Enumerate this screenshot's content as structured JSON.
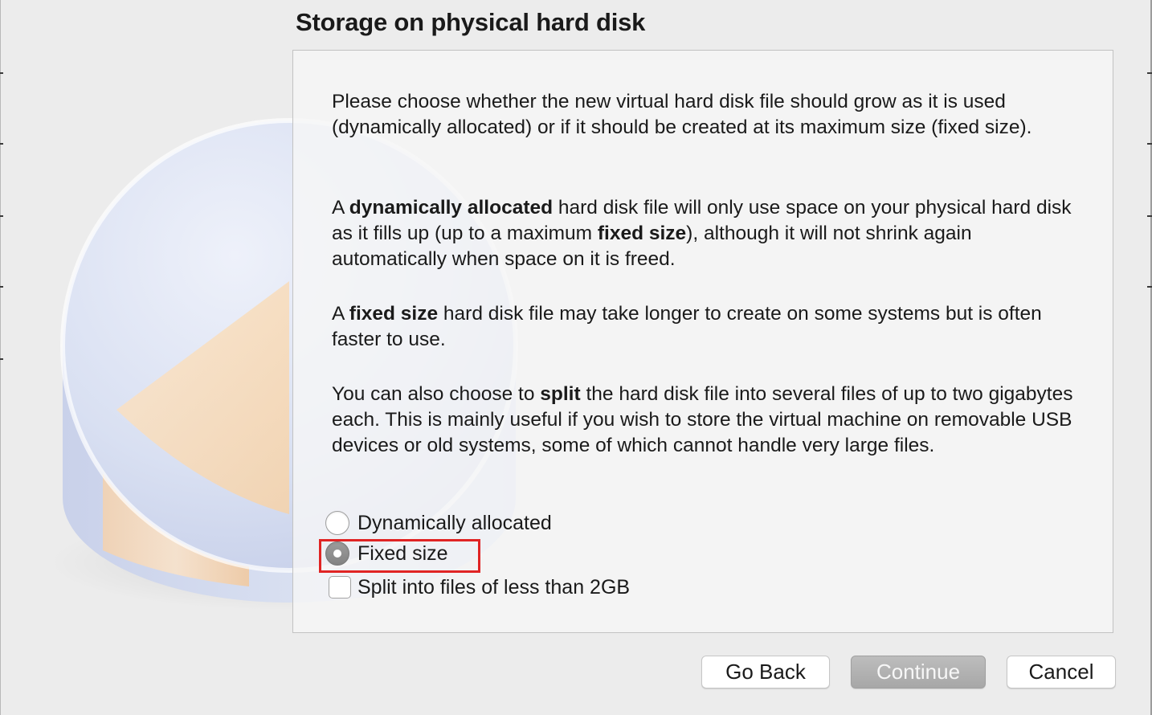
{
  "page": {
    "title": "Storage on physical hard disk",
    "paragraphs": [
      {
        "segments": [
          "Please choose whether the new virtual hard disk file should grow as it is used (dynamically allocated) or if it should be created at its maximum size (fixed size)."
        ]
      },
      {
        "segments": [
          "A ",
          "dynamically allocated",
          " hard disk file will only use space on your physical hard disk as it fills up (up to a maximum ",
          "fixed size",
          "), although it will not shrink again automatically when space on it is freed."
        ]
      },
      {
        "segments": [
          "A ",
          "fixed size",
          " hard disk file may take longer to create on some systems but is often faster to use."
        ]
      },
      {
        "segments": [
          "You can also choose to ",
          "split",
          " the hard disk file into several files of up to two gigabytes each. This is mainly useful if you wish to store the virtual machine on removable USB devices or old systems, some of which cannot handle very large files."
        ]
      }
    ]
  },
  "options": {
    "dynamic_label": "Dynamically allocated",
    "dynamic_checked": false,
    "fixed_label": "Fixed size",
    "fixed_checked": true,
    "split_label": "Split into files of less than 2GB",
    "split_checked": false
  },
  "buttons": {
    "back": "Go Back",
    "continue": "Continue",
    "cancel": "Cancel"
  },
  "colors": {
    "highlight": "#e02424",
    "primary_button": "#a9a9a9",
    "disk_blue": "#c8d4ee",
    "disk_orange": "#f7d7b0"
  },
  "icons": {
    "illustration": "hard-disk-pie-icon"
  }
}
